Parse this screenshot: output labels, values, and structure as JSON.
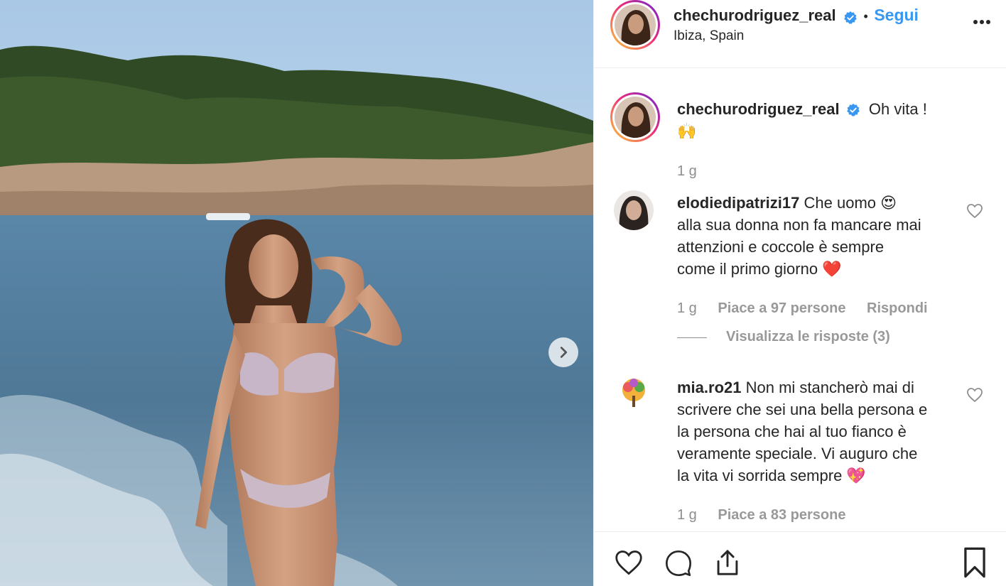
{
  "post": {
    "username": "chechurodriguez_real",
    "dot": "•",
    "follow_label": "Segui",
    "location": "Ibiza, Spain",
    "caption": "Oh vita !",
    "caption_emoji": "🙌",
    "caption_age": "1 g"
  },
  "comments": [
    {
      "username": "elodiedipatrizi17",
      "lines": [
        "Che uomo 😍",
        "alla sua donna non fa mancare mai",
        "attenzioni e coccole è sempre",
        "come il primo giorno ❤️"
      ],
      "age": "1 g",
      "likes": "Piace a 97 persone",
      "reply": "Rispondi",
      "view_replies": "Visualizza le risposte (3)"
    },
    {
      "username": "mia.ro21",
      "lines": [
        "Non mi stancherò mai di",
        "scrivere che sei una bella persona e",
        "la persona che hai al tuo fianco è",
        "veramente speciale. Vi auguro che",
        "la vita vi sorrida sempre 💖"
      ],
      "age": "1 g",
      "likes": "Piace a 83 persone"
    }
  ],
  "colors": {
    "accent": "#3897f0",
    "text": "#262626",
    "secondary": "#8e8e8e",
    "border": "#efefef"
  },
  "icons": {
    "next": "chevron-right-icon",
    "more": "more-horizontal-icon",
    "verified": "verified-badge-icon",
    "like": "heart-icon",
    "comment": "comment-icon",
    "share": "share-icon",
    "save": "bookmark-icon"
  }
}
